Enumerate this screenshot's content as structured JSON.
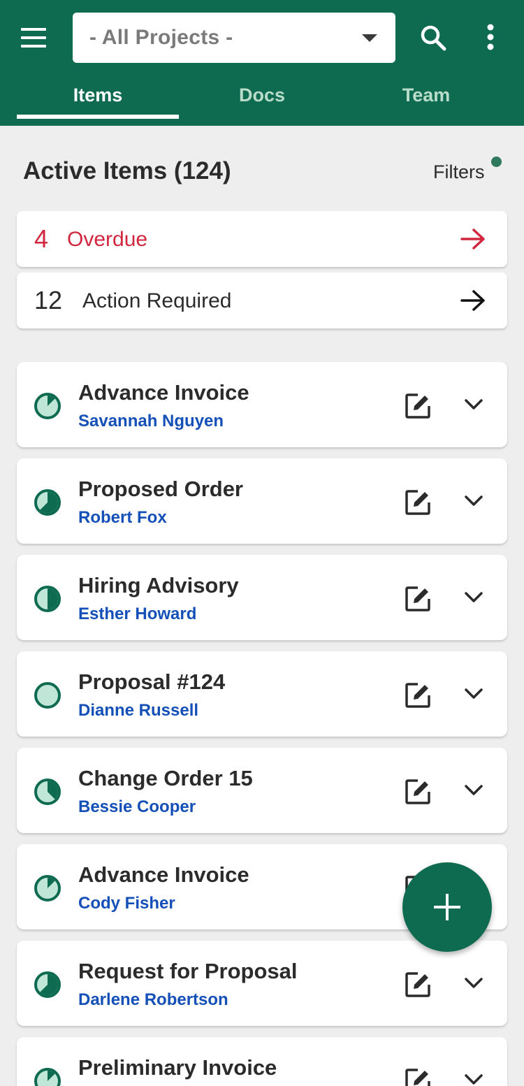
{
  "header": {
    "project_select": {
      "value": "- All Projects -"
    },
    "tabs": [
      {
        "label": "Items",
        "active": true
      },
      {
        "label": "Docs",
        "active": false
      },
      {
        "label": "Team",
        "active": false
      }
    ],
    "icons": {
      "menu": "hamburger-menu-icon",
      "search": "search-icon",
      "more": "more-vertical-icon"
    }
  },
  "section": {
    "title": "Active Items (124)",
    "filters_label": "Filters",
    "filters_active": true
  },
  "summary": {
    "overdue": {
      "count": "4",
      "label": "Overdue",
      "color": "#d0273e"
    },
    "action_required": {
      "count": "12",
      "label": "Action Required"
    }
  },
  "items": [
    {
      "title": "Advance Invoice",
      "assignee": "Savannah Nguyen",
      "progress": 0.125
    },
    {
      "title": "Proposed Order",
      "assignee": "Robert Fox",
      "progress": 0.625
    },
    {
      "title": "Hiring Advisory",
      "assignee": "Esther Howard",
      "progress": 0.5
    },
    {
      "title": "Proposal #124",
      "assignee": "Dianne Russell",
      "progress": 0
    },
    {
      "title": "Change Order 15",
      "assignee": "Bessie Cooper",
      "progress": 0.375
    },
    {
      "title": "Advance Invoice",
      "assignee": "Cody Fisher",
      "progress": 0.125
    },
    {
      "title": "Request for Proposal",
      "assignee": "Darlene Robertson",
      "progress": 0.625
    },
    {
      "title": "Preliminary Invoice",
      "assignee": "",
      "progress": 0.125
    }
  ],
  "colors": {
    "brand": "#0f6b4f",
    "status_fill": "#bfe6d6",
    "assignee_link": "#1450b8",
    "overdue": "#d0273e"
  },
  "fab": {
    "icon": "plus-icon"
  }
}
